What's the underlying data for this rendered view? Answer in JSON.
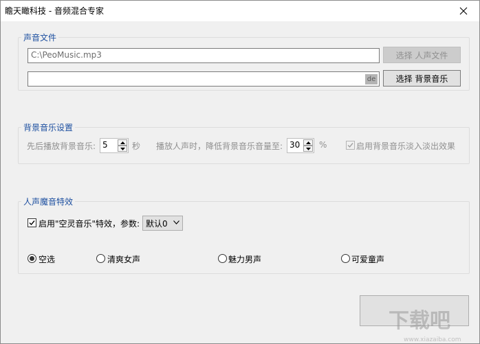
{
  "window": {
    "title": "瞻天瞰科技 - 音频混合专家"
  },
  "voice_file": {
    "legend": "声音文件",
    "voice_path": "C:\\PeoMusic.mp3",
    "select_voice_label": "选择 人声文件",
    "bg_path": "",
    "bg_tag": "de",
    "select_bg_label": "选择 背景音乐"
  },
  "bg_settings": {
    "legend": "背景音乐设置",
    "delay_label": "先后播放背景音乐:",
    "delay_value": "5",
    "delay_unit": "秒",
    "reduce_label": "播放人声时，降低背景音乐音量至:",
    "reduce_value": "30",
    "reduce_unit": "%",
    "fade_label": "启用背景音乐淡入淡出效果",
    "fade_checked": true
  },
  "effects": {
    "legend": "人声魔音特效",
    "enable_label": "启用\"空灵音乐\"特效，参数:",
    "enable_checked": true,
    "param_value": "默认0",
    "radios": [
      {
        "label": "空选",
        "selected": true
      },
      {
        "label": "清爽女声",
        "selected": false
      },
      {
        "label": "魅力男声",
        "selected": false
      },
      {
        "label": "可爱童声",
        "selected": false
      }
    ]
  },
  "watermark": {
    "brand": "下载吧",
    "url": "www.xiazaiba.com"
  },
  "icons": {
    "close": "close-icon",
    "check": "check-icon",
    "spin_up": "arrow-up-icon",
    "spin_down": "arrow-down-icon",
    "dropdown": "chevron-down-icon"
  }
}
